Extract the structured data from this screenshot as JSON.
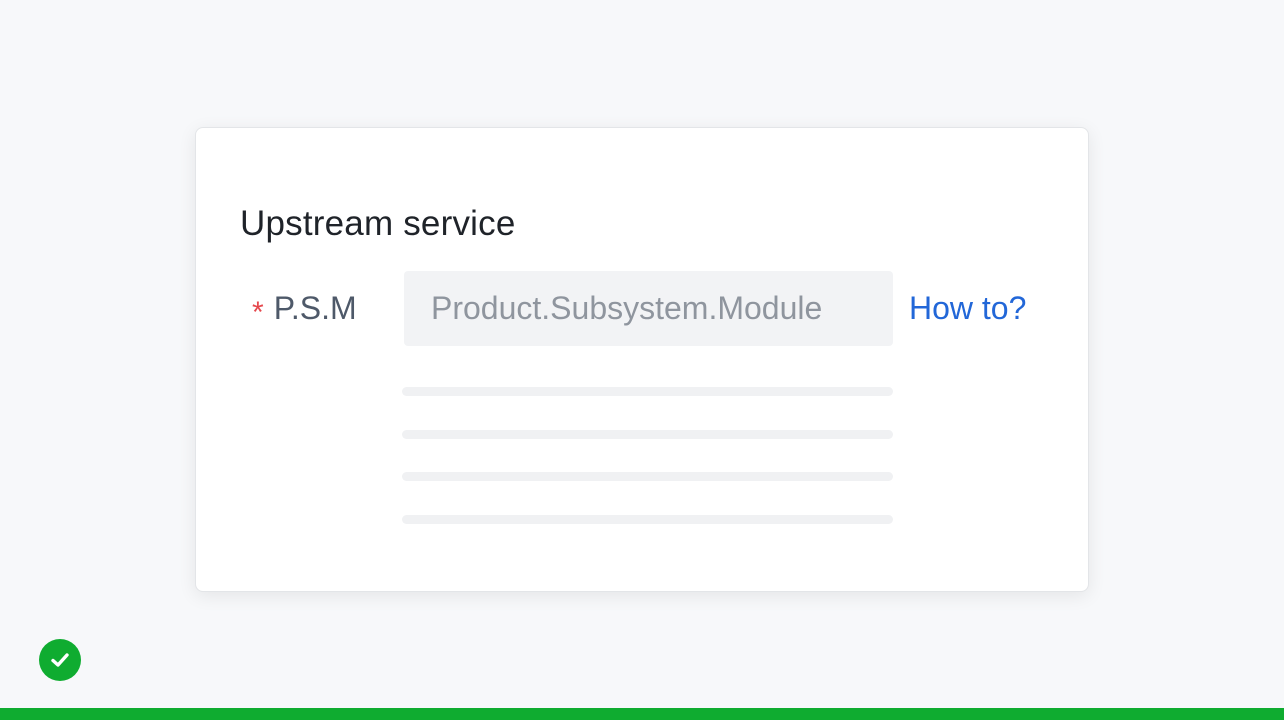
{
  "form": {
    "section_title": "Upstream service",
    "psm_field": {
      "required_mark": "*",
      "label": "P.S.M",
      "value": "",
      "placeholder": "Product.Subsystem.Module"
    },
    "help_link": "How to?"
  },
  "status": {
    "icon": "check-circle-icon",
    "state": "success",
    "color": "#0fac30"
  },
  "colors": {
    "required": "#e5484d",
    "link": "#2267d8",
    "success": "#0fac30"
  }
}
